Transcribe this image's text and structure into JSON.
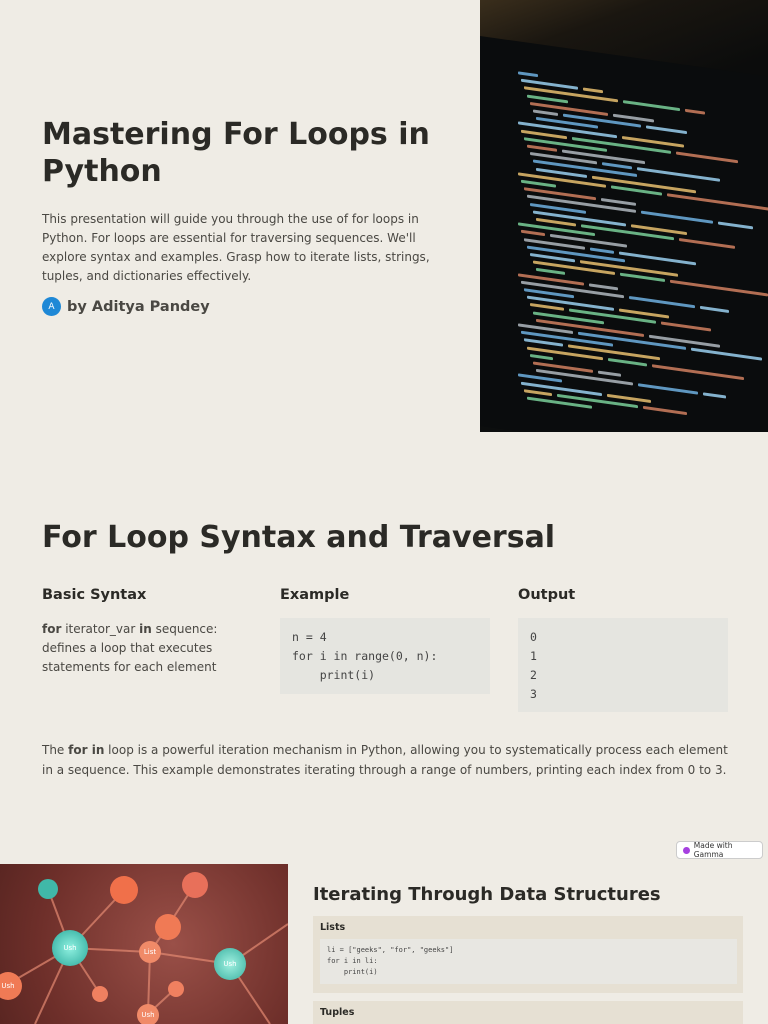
{
  "hero": {
    "title": " Mastering For Loops in Python",
    "intro": "This presentation will guide you through the use of for loops in Python. For loops are essential for traversing sequences. We'll explore syntax and examples. Grasp how to iterate lists, strings, tuples, and dictionaries effectively.",
    "avatar_letter": "A",
    "author": "by Aditya Pandey"
  },
  "syntax_section": {
    "title": "For Loop Syntax and Traversal",
    "columns": {
      "basic": {
        "heading": "Basic Syntax",
        "kw1": "for",
        "t1": " iterator_var ",
        "kw2": "in",
        "t2": " sequence: defines a loop that executes statements for each element"
      },
      "example": {
        "heading": "Example",
        "code": "n = 4\nfor i in range(0, n):\n    print(i)"
      },
      "output": {
        "heading": "Output",
        "code": "0\n1\n2\n3"
      }
    },
    "paragraph": {
      "t1": "The ",
      "kw": "for in",
      "t2": " loop is a powerful iteration mechanism in Python, allowing you to systematically process each element in a sequence. This example demonstrates iterating through a range of numbers, printing each index from 0 to 3."
    }
  },
  "badge": {
    "label": "Made with Gamma"
  },
  "data_structures": {
    "title": "Iterating Through Data Structures",
    "cards": [
      {
        "label": "Lists",
        "code": "li = [\"geeks\", \"for\", \"geeks\"]\nfor i in li:\n    print(i)"
      },
      {
        "label": "Tuples"
      }
    ]
  },
  "colors": {
    "background": "#efece5",
    "avatar": "#1e88d6",
    "card": "#e6e0d3"
  }
}
